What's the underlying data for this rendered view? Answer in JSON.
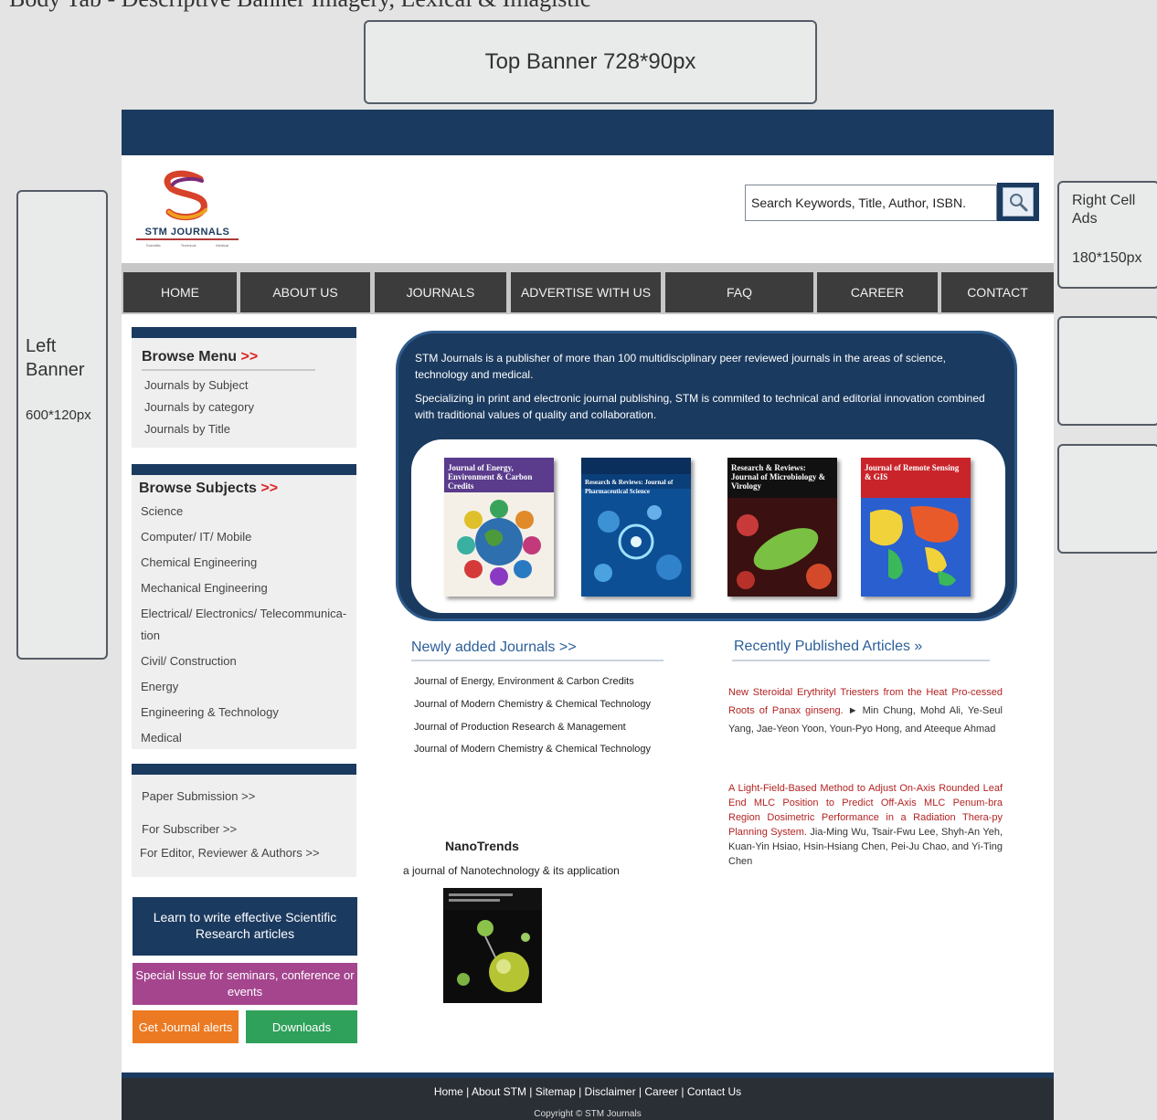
{
  "top_strip_text": "Body Tab - Descriptive Banner Imagery, Lexical & Imagistic",
  "ads": {
    "top_banner": "Top Banner 728*90px",
    "left_banner_title": "Left Banner",
    "left_banner_size": "600*120px",
    "right_cell_title": "Right Cell Ads",
    "right_cell_size": "180*150px"
  },
  "logo": {
    "text": "STM JOURNALS",
    "sub": [
      "Scientific",
      "Technical",
      "Medical"
    ]
  },
  "search": {
    "placeholder": "Search Keywords, Title, Author, ISBN."
  },
  "nav": [
    "HOME",
    "ABOUT US",
    "JOURNALS",
    "ADVERTISE WITH US",
    "FAQ",
    "CAREER",
    "CONTACT"
  ],
  "browse_menu": {
    "title": "Browse Menu",
    "arrows": ">>",
    "items": [
      "Journals by Subject",
      "Journals by category",
      "Journals by Title"
    ]
  },
  "browse_subjects": {
    "title": "Browse Subjects",
    "arrows": ">>",
    "items": [
      "Science",
      "Computer/ IT/ Mobile",
      "Chemical Engineering",
      "Mechanical Engineering",
      "Electrical/ Electronics/ Telecommunica-",
      "tion",
      "Civil/ Construction",
      "Energy",
      "Engineering & Technology",
      "Medical"
    ]
  },
  "links_panel": [
    "Paper Submission >>",
    "For Subscriber >>",
    "For Editor, Reviewer & Authors >>"
  ],
  "buttons": {
    "learn": "Learn to write effective Scientific Research articles",
    "special": "Special Issue for seminars, conference or events",
    "alerts": "Get Journal alerts",
    "downloads": "Downloads"
  },
  "intro": {
    "p1": "STM Journals is a publisher of  more than 100 multidisciplinary peer reviewed journals in the areas of science, technology and medical.",
    "p2": "Specializing in print and electronic journal publishing, STM is commited to technical and editorial innovation combined with traditional values of quality and collaboration."
  },
  "covers": [
    {
      "title": "Journal of Energy, Environment & Carbon Credits",
      "color": "#5a3b8c"
    },
    {
      "title": "Research & Reviews: Journal of Pharmaceutical Science",
      "color": "#0b3f7a"
    },
    {
      "title": "Research & Reviews: Journal of Microbiology & Virology",
      "color": "#111111"
    },
    {
      "title": "Journal of Remote Sensing & GIS",
      "color": "#c8242a"
    }
  ],
  "newly_added": {
    "title": "Newly added Journals >>",
    "items": [
      "Journal of Energy, Environment & Carbon Credits",
      "Journal of Modern Chemistry & Chemical Technology",
      "Journal of Production Research & Management",
      "Journal of Modern Chemistry & Chemical Technology"
    ]
  },
  "recent_articles": {
    "title": "Recently Published Articles »",
    "a1_red": "New Steroidal Erythrityl Triesters from the Heat Pro-cessed Roots of Panax ginseng.",
    "a1_rest": " ► Min Chung, Mohd Ali, Ye-Seul Yang, Jae-Yeon Yoon, Youn-Pyo Hong, and Ateeque Ahmad",
    "a2_red": "A Light-Field-Based Method to Adjust On-Axis Rounded Leaf End MLC Position to Predict Off-Axis MLC Penum-bra Region Dosimetric Performance in a Radiation Thera-py Planning System.",
    "a2_rest": " Jia-Ming Wu, Tsair-Fwu Lee, Shyh-An Yeh, Kuan-Yin Hsiao, Hsin-Hsiang Chen, Pei-Ju Chao, and Yi-Ting Chen"
  },
  "nano": {
    "title": "NanoTrends",
    "subtitle": "a journal of Nanotechnology & its application"
  },
  "footer": {
    "links": "Home | About STM | Sitemap | Disclaimer | Career | Contact Us",
    "copyright": "Copyright © STM Journals"
  },
  "colors": {
    "navy": "#1b3a5f",
    "nav_dark": "#3c3c3c",
    "accent_red": "#b42323",
    "orange": "#ec7a22",
    "green": "#2fa15a",
    "purple": "#a4458e"
  }
}
